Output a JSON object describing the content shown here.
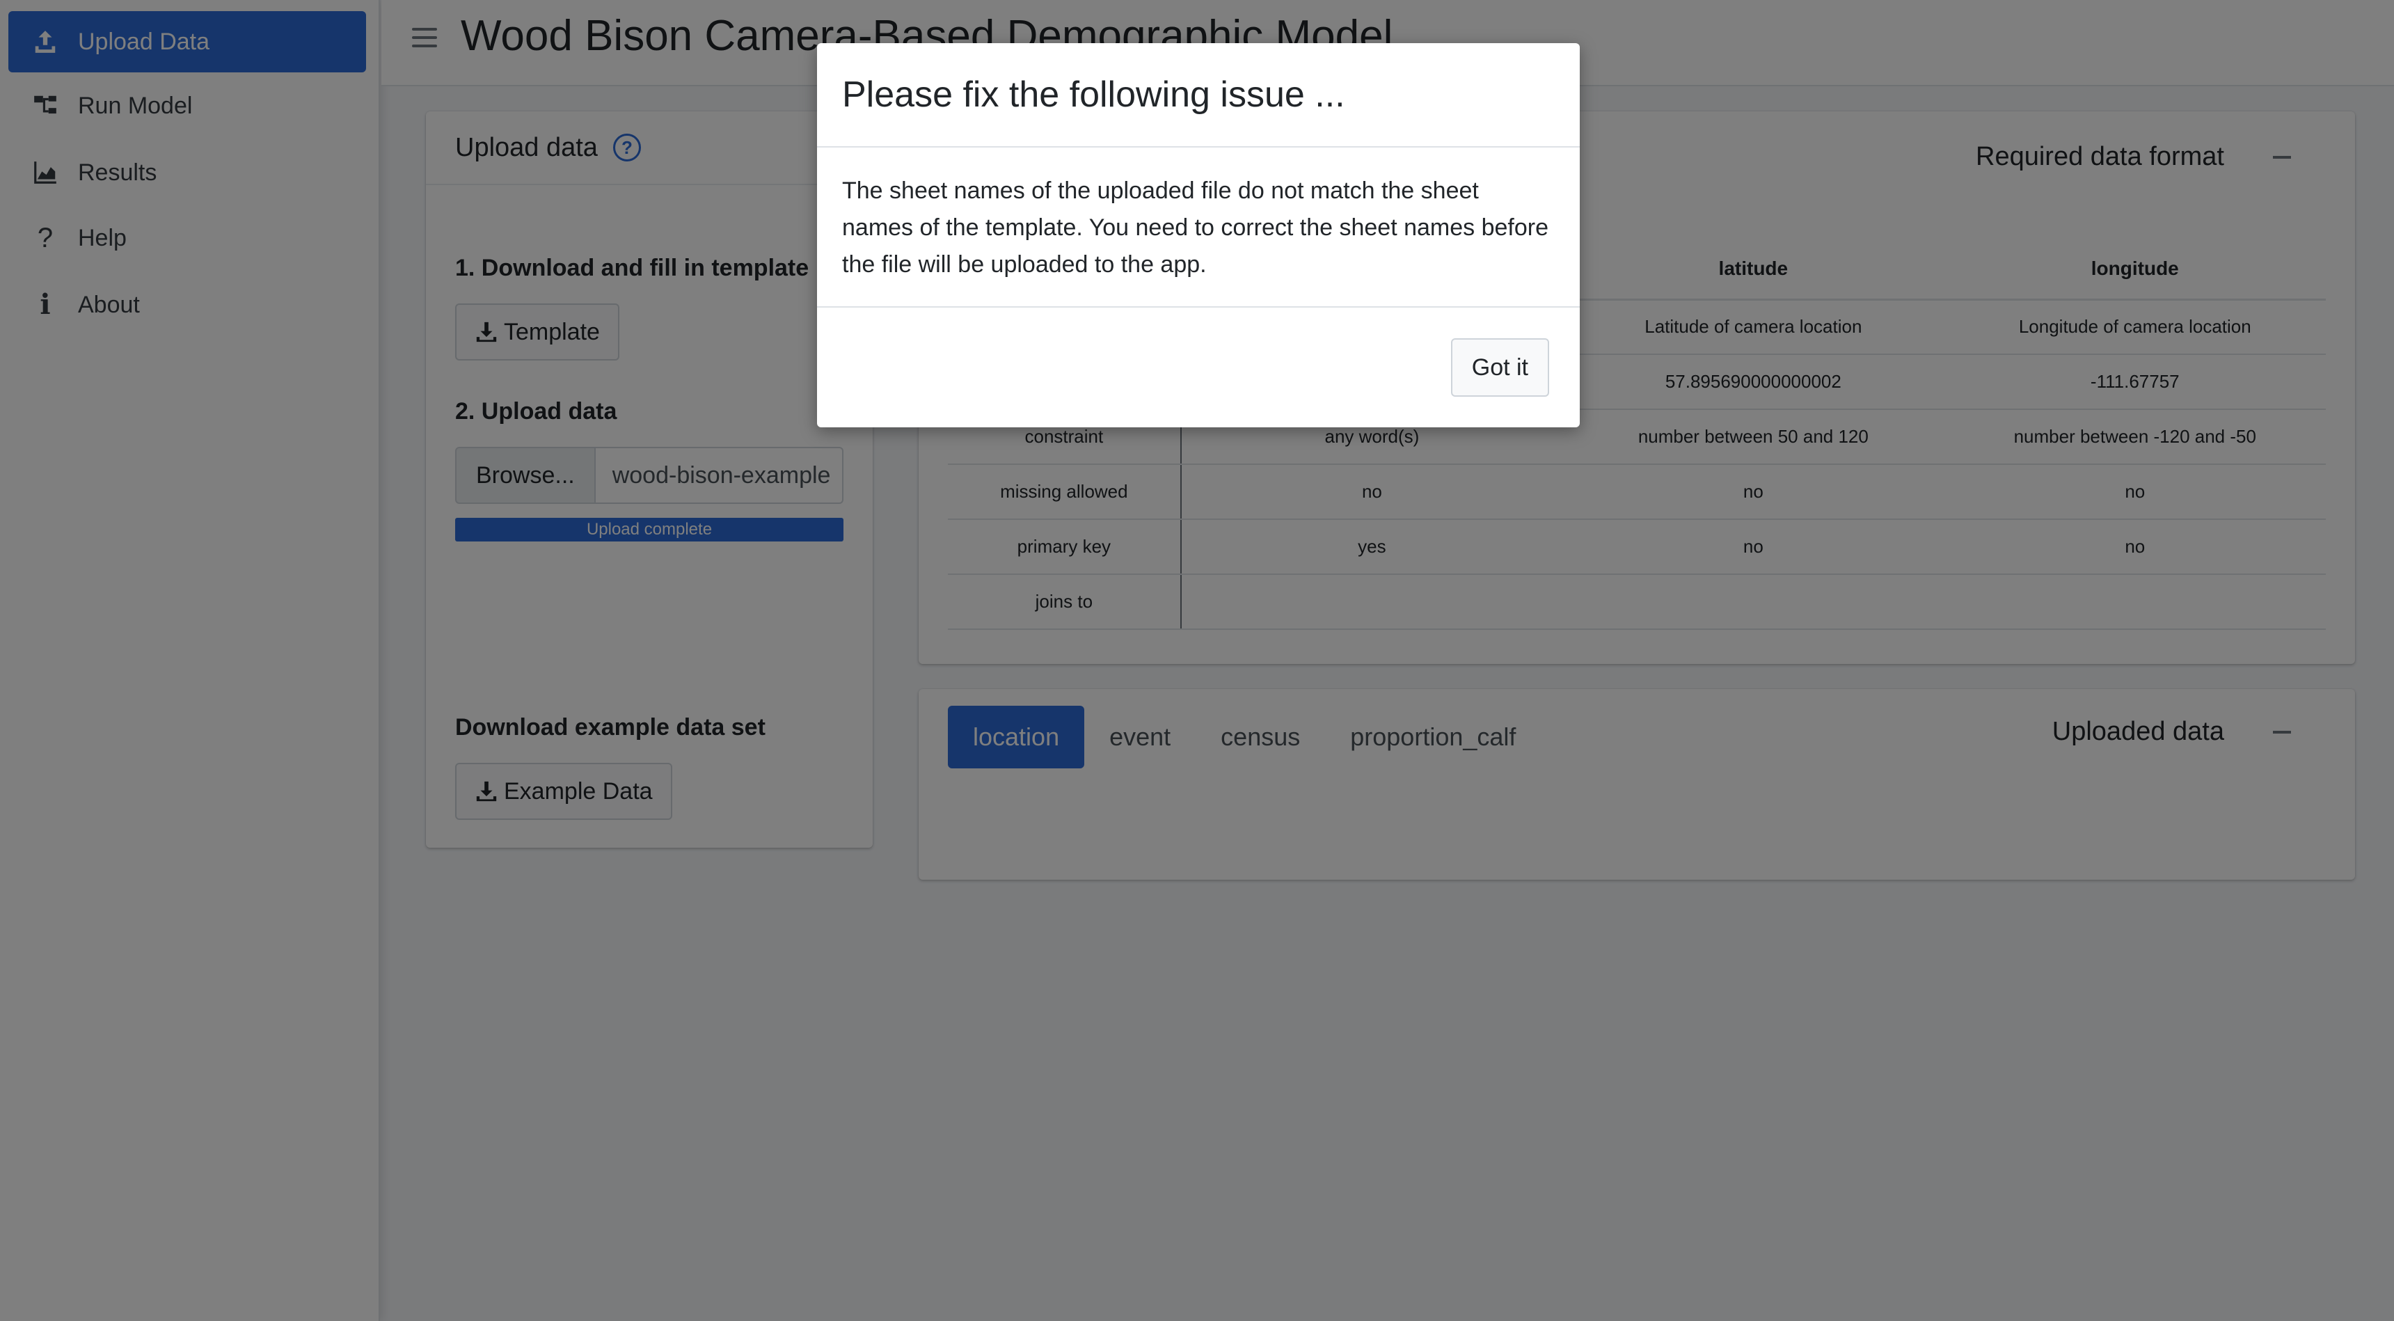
{
  "app": {
    "title": "Wood Bison Camera-Based Demographic Model"
  },
  "sidebar": {
    "items": [
      {
        "label": "Upload Data",
        "icon": "upload-icon",
        "active": true
      },
      {
        "label": "Run Model",
        "icon": "sitemap-icon",
        "active": false
      },
      {
        "label": "Results",
        "icon": "area-chart-icon",
        "active": false
      },
      {
        "label": "Help",
        "icon": "question-icon",
        "active": false
      },
      {
        "label": "About",
        "icon": "info-icon",
        "active": false
      }
    ]
  },
  "upload_card": {
    "title": "Upload data",
    "step1_label": "1. Download and fill in template",
    "template_button": "Template",
    "step2_label": "2. Upload data",
    "browse_label": "Browse...",
    "file_name": "wood-bison-example",
    "progress_text": "Upload complete",
    "progress_fraction": 1.0,
    "example_label": "Download example data set",
    "example_button": "Example Data"
  },
  "format_card": {
    "title": "Required data format",
    "columns": [
      "",
      "",
      "latitude",
      "longitude"
    ],
    "rows": [
      [
        "",
        "",
        "Latitude of camera location",
        "Longitude of camera location"
      ],
      [
        "",
        "",
        "57.895690000000002",
        "-111.67757"
      ],
      [
        "constraint",
        "any word(s)",
        "number between 50 and 120",
        "number between -120 and -50"
      ],
      [
        "missing allowed",
        "no",
        "no",
        "no"
      ],
      [
        "primary key",
        "yes",
        "no",
        "no"
      ],
      [
        "joins to",
        "",
        "",
        ""
      ]
    ]
  },
  "uploaded_card": {
    "title": "Uploaded data",
    "tabs": [
      {
        "label": "location",
        "active": true
      },
      {
        "label": "event",
        "active": false
      },
      {
        "label": "census",
        "active": false
      },
      {
        "label": "proportion_calf",
        "active": false
      }
    ]
  },
  "modal": {
    "title": "Please fix the following issue ...",
    "body": "The sheet names of the uploaded file do not match the sheet names of the template. You need to correct the sheet names before the file will be uploaded to the app.",
    "button": "Got it"
  },
  "colors": {
    "primary": "#2c6bd6",
    "overlay": "rgba(0,0,0,0.5)"
  }
}
